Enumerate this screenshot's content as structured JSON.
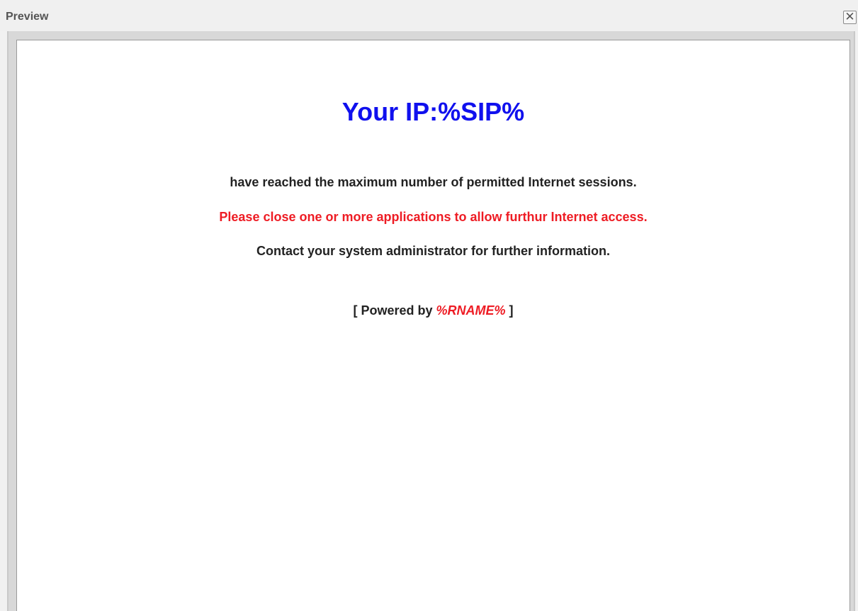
{
  "window": {
    "title": "Preview",
    "close_glyph": "✕"
  },
  "page": {
    "heading": "Your IP:%SIP%",
    "message": "have reached the maximum number of permitted Internet sessions.",
    "warning": "Please close one or more applications to allow furthur Internet access.",
    "contact": "Contact your system administrator for further information.",
    "powered_prefix": "[ Powered by ",
    "powered_name": "%RNAME%",
    "powered_suffix": " ]"
  },
  "colors": {
    "heading": "#1010ee",
    "warning": "#ee1c24",
    "text": "#222222"
  }
}
